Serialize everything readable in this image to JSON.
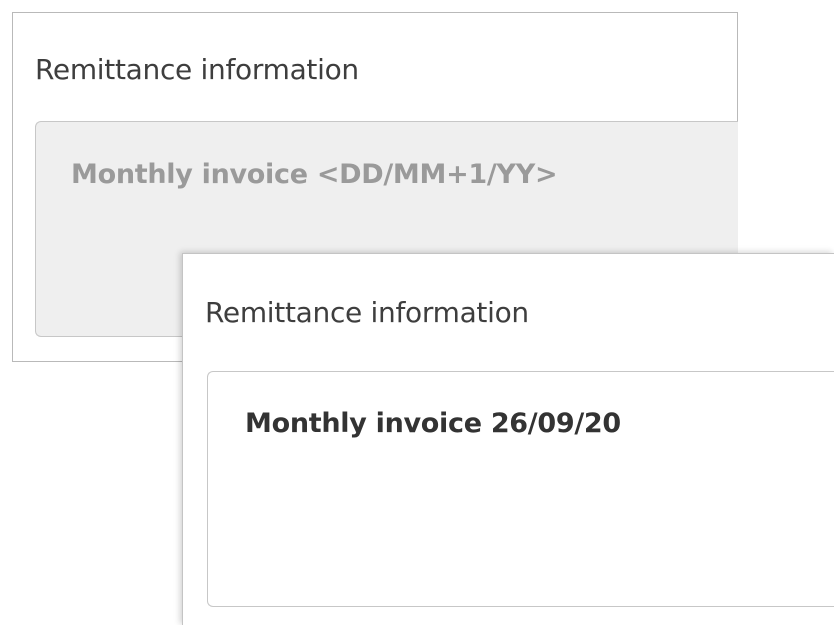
{
  "template_panel": {
    "label": "Remittance information",
    "value": "Monthly invoice <DD/MM+1/YY>"
  },
  "result_panel": {
    "label": "Remittance information",
    "value": "Monthly invoice 26/09/20"
  }
}
